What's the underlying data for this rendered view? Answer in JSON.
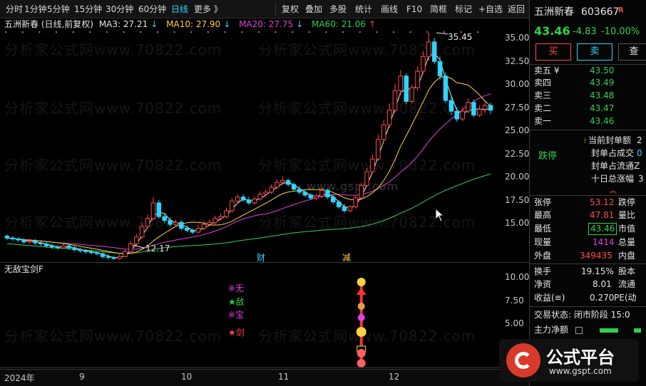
{
  "toolbar": {
    "periods": [
      "分时",
      "1分钟",
      "5分钟",
      "15分钟",
      "30分钟",
      "60分钟",
      "日线",
      "更多 》"
    ],
    "selected_period": "日线",
    "tools": [
      "复权",
      "叠加",
      "多股",
      "统计",
      "画线",
      "F10",
      "简框",
      "标记",
      "+自选",
      "返回"
    ]
  },
  "main_chart": {
    "title": "五洲新春 (日线,前复权)",
    "ma": [
      {
        "label": "MA3: 27.21",
        "arrow": "↓",
        "color": "#e6e6e6"
      },
      {
        "label": "MA10: 27.90",
        "arrow": "↓",
        "color": "#ffd23f"
      },
      {
        "label": "MA20: 27.75",
        "arrow": "↓",
        "color": "#e040e0"
      },
      {
        "label": "MA60: 21.06",
        "arrow": "↑",
        "color": "#3ad14a"
      }
    ],
    "y_ticks": [
      "35.00",
      "32.50",
      "30.00",
      "27.50",
      "25.00",
      "22.50",
      "20.00",
      "17.50",
      "15.00"
    ],
    "high_label": "35.45",
    "low_label": "12.17",
    "markers": [
      "财",
      "减"
    ],
    "watermark": "分析家公式网www.70822.com",
    "center_watermark": "www.gspt.com"
  },
  "indicator": {
    "title": "无敌宝剑F",
    "y_ticks": [
      "10.00",
      "7.50",
      "5.00"
    ],
    "signals": [
      "※无",
      "★敌",
      "※宝",
      "★剑"
    ]
  },
  "x_axis": [
    "2024年",
    "9",
    "10",
    "11",
    "12"
  ],
  "chart_data": {
    "type": "candlestick",
    "ylim": [
      12,
      36
    ],
    "x": [
      "2024-08-21",
      "2024-08-22",
      "2024-08-23",
      "2024-08-26",
      "2024-08-27",
      "2024-08-28",
      "2024-08-29",
      "2024-08-30",
      "2024-09-02",
      "2024-09-03",
      "2024-09-04",
      "2024-09-05",
      "2024-09-06",
      "2024-09-09",
      "2024-09-10",
      "2024-09-11",
      "2024-09-12",
      "2024-09-13",
      "2024-09-18",
      "2024-09-19",
      "2024-09-20",
      "2024-09-23",
      "2024-09-24",
      "2024-09-25",
      "2024-09-26",
      "2024-09-27",
      "2024-09-30",
      "2024-10-08",
      "2024-10-09",
      "2024-10-10",
      "2024-10-11",
      "2024-10-14",
      "2024-10-15",
      "2024-10-16",
      "2024-10-17",
      "2024-10-18",
      "2024-10-21",
      "2024-10-22",
      "2024-10-23",
      "2024-10-24",
      "2024-10-25",
      "2024-10-28",
      "2024-10-29",
      "2024-10-30",
      "2024-10-31",
      "2024-11-01",
      "2024-11-04",
      "2024-11-05",
      "2024-11-06",
      "2024-11-07",
      "2024-11-08",
      "2024-11-11",
      "2024-11-12",
      "2024-11-13",
      "2024-11-14",
      "2024-11-15",
      "2024-11-18",
      "2024-11-19",
      "2024-11-20",
      "2024-11-21",
      "2024-11-22",
      "2024-11-25",
      "2024-11-26",
      "2024-11-27",
      "2024-11-28",
      "2024-11-29",
      "2024-12-02",
      "2024-12-03",
      "2024-12-04",
      "2024-12-05",
      "2024-12-06",
      "2024-12-09",
      "2024-12-10",
      "2024-12-11",
      "2024-12-12",
      "2024-12-13",
      "2024-12-16",
      "2024-12-17",
      "2024-12-18",
      "2024-12-19",
      "2024-12-20",
      "2024-12-23",
      "2024-12-24",
      "2024-12-25",
      "2024-12-26",
      "2024-12-27",
      "2024-12-30"
    ],
    "open": [
      14.6,
      14.4,
      14.3,
      14.2,
      14.0,
      14.1,
      13.9,
      13.8,
      13.6,
      13.5,
      13.4,
      13.6,
      13.4,
      13.2,
      13.1,
      13.0,
      12.9,
      12.8,
      12.5,
      12.4,
      12.3,
      12.5,
      13.0,
      13.8,
      14.5,
      15.6,
      16.4,
      18.0,
      16.6,
      16.2,
      15.8,
      16.0,
      15.4,
      15.2,
      15.0,
      15.4,
      15.8,
      16.0,
      16.4,
      16.6,
      17.2,
      18.2,
      18.6,
      18.3,
      18.0,
      18.4,
      18.9,
      19.1,
      19.6,
      20.1,
      20.3,
      19.9,
      19.4,
      19.1,
      18.8,
      18.5,
      18.7,
      19.3,
      18.6,
      18.1,
      17.6,
      17.2,
      17.6,
      18.5,
      19.8,
      21.2,
      22.5,
      24.5,
      26.0,
      27.5,
      29.5,
      31.0,
      28.4,
      29.8,
      31.5,
      33.0,
      34.5,
      32.5,
      31.0,
      28.5,
      27.4,
      26.6,
      27.4,
      28.3,
      27.0,
      27.6,
      28.0
    ],
    "close": [
      14.4,
      14.3,
      14.2,
      14.0,
      14.1,
      13.9,
      13.8,
      13.6,
      13.5,
      13.4,
      13.6,
      13.4,
      13.2,
      13.1,
      13.0,
      12.9,
      12.8,
      12.5,
      12.4,
      12.3,
      12.5,
      13.0,
      13.8,
      14.5,
      15.6,
      16.4,
      18.0,
      16.6,
      16.2,
      15.8,
      16.0,
      15.4,
      15.2,
      15.0,
      15.4,
      15.8,
      16.0,
      16.4,
      16.6,
      17.2,
      18.2,
      18.6,
      18.3,
      18.0,
      18.4,
      18.9,
      19.1,
      19.6,
      20.1,
      20.3,
      19.9,
      19.4,
      19.1,
      18.8,
      18.5,
      18.7,
      19.3,
      18.6,
      18.1,
      17.6,
      17.2,
      17.6,
      18.5,
      19.8,
      21.2,
      22.5,
      24.5,
      26.0,
      27.5,
      29.5,
      31.0,
      28.4,
      29.8,
      31.5,
      33.0,
      34.5,
      32.5,
      31.0,
      28.5,
      27.4,
      26.6,
      27.4,
      28.3,
      27.0,
      27.6,
      28.0,
      27.5
    ],
    "high": [
      14.8,
      14.6,
      14.5,
      14.4,
      14.3,
      14.3,
      14.1,
      14.0,
      13.8,
      13.7,
      13.8,
      13.8,
      13.6,
      13.4,
      13.3,
      13.2,
      13.1,
      13.0,
      12.7,
      12.6,
      12.7,
      13.2,
      14.1,
      14.8,
      16.0,
      16.8,
      18.6,
      18.3,
      16.9,
      16.5,
      16.3,
      16.2,
      15.7,
      15.4,
      15.7,
      16.1,
      16.3,
      16.7,
      16.9,
      17.5,
      18.5,
      18.9,
      18.9,
      18.6,
      18.7,
      19.2,
      19.4,
      19.9,
      20.4,
      20.7,
      20.5,
      20.1,
      19.7,
      19.4,
      19.0,
      18.9,
      19.6,
      19.5,
      18.9,
      18.3,
      17.9,
      17.8,
      18.8,
      20.1,
      21.6,
      23.0,
      25.0,
      26.5,
      28.2,
      30.2,
      31.6,
      31.3,
      30.1,
      32.0,
      33.5,
      35.45,
      34.9,
      33.0,
      31.4,
      28.9,
      27.8,
      27.8,
      28.7,
      28.6,
      28.0,
      28.4,
      28.3
    ],
    "low": [
      14.2,
      14.1,
      14.0,
      13.8,
      13.8,
      13.7,
      13.6,
      13.4,
      13.3,
      13.2,
      13.3,
      13.2,
      13.0,
      12.9,
      12.8,
      12.7,
      12.6,
      12.3,
      12.2,
      12.17,
      12.2,
      12.4,
      12.9,
      13.6,
      14.3,
      15.4,
      16.2,
      16.4,
      15.9,
      15.6,
      15.6,
      15.2,
      15.0,
      14.8,
      14.9,
      15.2,
      15.6,
      15.8,
      16.2,
      16.4,
      17.0,
      18.0,
      18.1,
      17.8,
      17.8,
      18.2,
      18.7,
      18.9,
      19.4,
      19.8,
      19.7,
      19.2,
      18.9,
      18.6,
      18.3,
      18.3,
      18.5,
      18.4,
      17.9,
      17.4,
      17.0,
      17.0,
      17.4,
      18.3,
      19.6,
      21.0,
      22.3,
      24.2,
      25.7,
      27.2,
      29.0,
      28.1,
      28.2,
      29.5,
      31.2,
      32.6,
      32.2,
      30.6,
      28.2,
      27.0,
      26.3,
      26.4,
      27.2,
      26.8,
      26.8,
      27.2,
      27.1
    ]
  },
  "ind_data": {
    "ylim": [
      0,
      11.5
    ],
    "signal_x_index": 63
  },
  "rpanel": {
    "name": "五洲新春",
    "code": "603667",
    "badge": "R",
    "price": "43.46",
    "change": "-4.83",
    "pct": "-10.00%",
    "buy": "买",
    "sell": "卖",
    "more": "查",
    "asks": [
      {
        "label": "卖五 ¥",
        "price": "43.50"
      },
      {
        "label": "卖四",
        "price": "43.49"
      },
      {
        "label": "卖三",
        "price": "43.48"
      },
      {
        "label": "卖二",
        "price": "43.47"
      },
      {
        "label": "卖一",
        "price": "43.46"
      }
    ],
    "limit_status": "跌停",
    "seal": [
      {
        "label": "当前封单额",
        "value": "2"
      },
      {
        "label": "封单占成交",
        "value": "0"
      },
      {
        "label": "封单占流通Z",
        "value": ""
      },
      {
        "label": "十日总涨幅",
        "value": "3"
      }
    ],
    "stats": [
      {
        "l1": "张停",
        "v1": "53.12",
        "l2": "跌停"
      },
      {
        "l1": "最高",
        "v1": "47.81",
        "l2": "量比"
      },
      {
        "l1": "最低",
        "v1": "43.46",
        "l2": "市值"
      },
      {
        "l1": "现量",
        "v1": "1414",
        "l2": "总量"
      },
      {
        "l1": "外盘",
        "v1": "349435",
        "l2": "内盘"
      }
    ],
    "stats2": [
      {
        "l1": "换手",
        "v1": "19.15%",
        "l2": "股本"
      },
      {
        "l1": "净资",
        "v1": "8.01",
        "l2": "流通"
      },
      {
        "l1": "收益(≡)",
        "v1": "0.270",
        "l2": "PE(动"
      }
    ],
    "trade_status": "交易状态: 闭市阶段 15:0",
    "net_flow_label": "主力净额",
    "logo_text": "公式平台",
    "logo_url": "www.gspt.com"
  }
}
